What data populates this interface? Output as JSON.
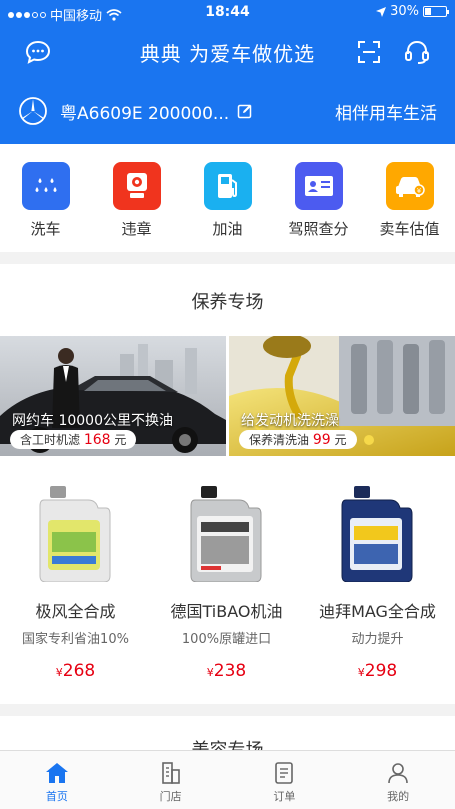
{
  "status_bar": {
    "carrier": "中国移动",
    "time": "18:44",
    "battery": "30%",
    "battery_level": 0.3
  },
  "header": {
    "title": "典典 为爱车做优选",
    "plate": "粤A6609E  200000...",
    "slogan": "相伴用车生活",
    "accent": "#1a75f0"
  },
  "quick_actions": [
    {
      "label": "洗车",
      "color": "#2f6ff0",
      "icon": "car-wash-icon"
    },
    {
      "label": "违章",
      "color": "#f0341e",
      "icon": "camera-icon"
    },
    {
      "label": "加油",
      "color": "#1ab0f0",
      "icon": "fuel-pump-icon"
    },
    {
      "label": "驾照查分",
      "color": "#4c5bf0",
      "icon": "license-icon"
    },
    {
      "label": "卖车估值",
      "color": "#ffa800",
      "icon": "car-sale-icon"
    }
  ],
  "maintenance": {
    "title": "保养专场",
    "banners": [
      {
        "caption": "网约车 10000公里不换油",
        "pill_prefix": "含工时机滤",
        "pill_number": "168",
        "pill_suffix": "元"
      },
      {
        "caption": "给发动机洗洗澡",
        "pill_prefix": "保养清洗油",
        "pill_number": "99",
        "pill_suffix": "元"
      }
    ],
    "products": [
      {
        "name": "极风全合成",
        "desc": "国家专利省油10%",
        "currency": "¥",
        "price": "268"
      },
      {
        "name": "德国TiBAO机油",
        "desc": "100%原罐进口",
        "currency": "¥",
        "price": "238"
      },
      {
        "name": "迪拜MAG全合成",
        "desc": "动力提升",
        "currency": "¥",
        "price": "298"
      }
    ]
  },
  "beauty": {
    "title": "美容专场"
  },
  "tabbar": [
    {
      "label": "首页",
      "icon": "home-icon",
      "active": true
    },
    {
      "label": "门店",
      "icon": "store-icon",
      "active": false
    },
    {
      "label": "订单",
      "icon": "order-icon",
      "active": false
    },
    {
      "label": "我的",
      "icon": "profile-icon",
      "active": false
    }
  ]
}
